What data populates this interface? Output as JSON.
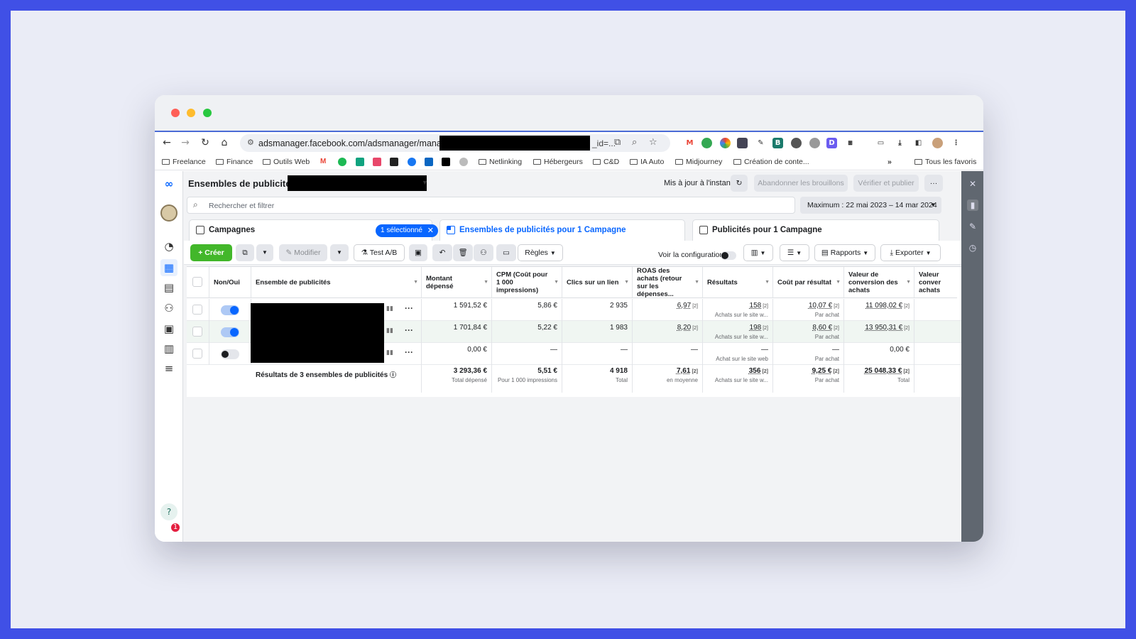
{
  "browser": {
    "url_prefix": "adsmanager.facebook.com/adsmanager/manage",
    "url_tail": "_id=...",
    "bookmarks": [
      "Freelance",
      "Finance",
      "Outils Web",
      "Netlinking",
      "Hébergeurs",
      "C&D",
      "IA Auto",
      "Midjourney",
      "Création de conte...",
      "Tous les favoris"
    ],
    "more_label": "»"
  },
  "header": {
    "title": "Ensembles de publicités",
    "updated": "Mis à jour à l'instant",
    "discard": "Abandonner les brouillons",
    "publish": "Vérifier et publier",
    "more": "···"
  },
  "search": {
    "placeholder": "Rechercher et filtrer",
    "date_range": "Maximum : 22 mai 2023 – 14 mar 2024"
  },
  "tabs": {
    "campaigns": "Campagnes",
    "selected_pill": "1 sélectionné",
    "adsets": "Ensembles de publicités pour 1 Campagne",
    "ads": "Publicités pour 1 Campagne"
  },
  "actions": {
    "create": "+ Créer",
    "edit": "Modifier",
    "ab_test": "Test A/B",
    "rules": "Règles",
    "view_config": "Voir la configuration",
    "reports": "Rapports",
    "export": "Exporter"
  },
  "table": {
    "headers": [
      "Non/Oui",
      "Ensemble de publicités",
      "Montant dépensé",
      "CPM (Coût pour 1 000 impressions)",
      "Clics sur un lien",
      "ROAS des achats (retour sur les dépenses...",
      "Résultats",
      "Coût par résultat",
      "Valeur de conversion des achats",
      "Valeur conver achats"
    ],
    "rows": [
      {
        "on": true,
        "spent": "1 591,52 €",
        "cpm": "5,86 €",
        "clicks": "2 935",
        "roas": "6,97",
        "results": "158",
        "results_sub": "Achats sur le site w...",
        "cpr": "10,07 €",
        "cpr_sub": "Par achat",
        "value": "11 098,02 €"
      },
      {
        "on": true,
        "spent": "1 701,84 €",
        "cpm": "5,22 €",
        "clicks": "1 983",
        "roas": "8,20",
        "results": "198",
        "results_sub": "Achats sur le site w...",
        "cpr": "8,60 €",
        "cpr_sub": "Par achat",
        "value": "13 950,31 €"
      },
      {
        "on": false,
        "spent": "0,00 €",
        "cpm": "—",
        "clicks": "—",
        "roas": "—",
        "results": "—",
        "results_sub": "Achat sur le site web",
        "cpr": "—",
        "cpr_sub": "Par achat",
        "value": "0,00 €"
      }
    ],
    "totals": {
      "label": "Résultats de 3 ensembles de publicités",
      "spent": "3 293,36 €",
      "spent_sub": "Total dépensé",
      "cpm": "5,51 €",
      "cpm_sub": "Pour 1 000 impressions",
      "clicks": "4 918",
      "clicks_sub": "Total",
      "roas": "7,61",
      "roas_sub": "en moyenne",
      "results": "356",
      "results_sub": "Achats sur le site w...",
      "cpr": "9,25 €",
      "cpr_sub": "Par achat",
      "value": "25 048,33 €",
      "value_sub": "Total"
    },
    "ref_mark": "[2]"
  },
  "badge_count": "1"
}
